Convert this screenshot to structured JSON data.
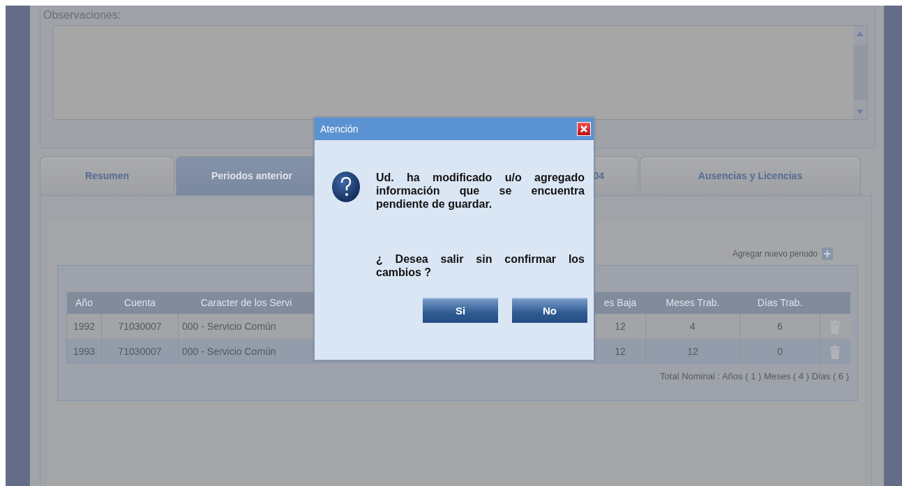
{
  "observations": {
    "label": "Observaciones:"
  },
  "tabs": [
    {
      "label": "Resumen",
      "selected": false
    },
    {
      "label": "Periodos anterior",
      "selected": true
    },
    {
      "label": "04",
      "selected": false
    },
    {
      "label": "Ausencias y Licencias",
      "selected": false
    }
  ],
  "add_link": {
    "label": "Agregar nuevo periodo"
  },
  "table": {
    "columns": [
      "Año",
      "Cuenta",
      "Caracter de los Servi",
      "es Baja",
      "Meses Trab.",
      "Días Trab."
    ],
    "rows": [
      {
        "cells": [
          "1992",
          "71030007",
          "000 - Servicio Común",
          "12",
          "4",
          "6"
        ]
      },
      {
        "cells": [
          "1993",
          "71030007",
          "000 - Servicio Común",
          "12",
          "12",
          "0"
        ]
      }
    ],
    "total": "Total Nominal : Años ( 1 ) Meses ( 4 ) Días ( 6 )"
  },
  "dialog": {
    "title": "Atención",
    "message": "Ud. ha modificado u/o agregado información que se encuentra pendiente de guardar.",
    "question": "¿ Desea salir sin confirmar los cambios ?",
    "buttons": [
      "Si",
      "No"
    ]
  }
}
